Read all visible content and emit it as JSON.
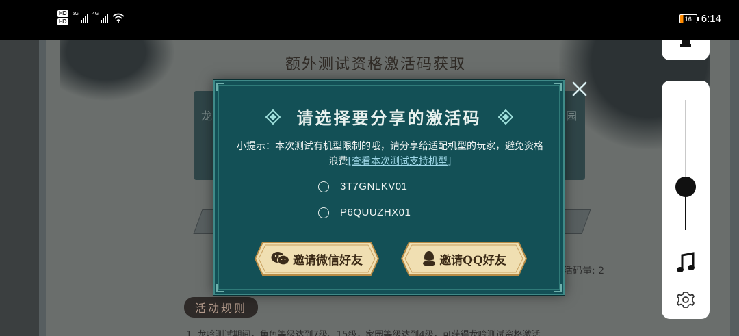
{
  "status_bar": {
    "hd_badge": "HD",
    "net_5g": "5G",
    "net_4g": "4G",
    "battery": "16",
    "time": "6:14"
  },
  "background": {
    "title": "额外测试资格激活码获取",
    "left_word": "龙",
    "right_word": "园",
    "count_text": "活码量: 2",
    "rules_label": "活动规则",
    "rules_line": "1. 龙吟测试期间，角色等级达到7级、15级，家园等级达到4级，可获得龙吟测试资格激活"
  },
  "dialog": {
    "title": "请选择要分享的激活码",
    "tip_text": "小提示：本次测试有机型限制的哦，请分享给适配机型的玩家，避免资格浪费",
    "tip_link": "[查看本次测试支持机型]",
    "codes": [
      {
        "code": "3T7GNLKV01",
        "selected": false
      },
      {
        "code": "P6QUUZHX01",
        "selected": false
      }
    ],
    "wechat_button": "邀请微信好友",
    "qq_button": "邀请QQ好友",
    "accent_color": "#135056"
  },
  "volume": {
    "level": 0.33
  }
}
